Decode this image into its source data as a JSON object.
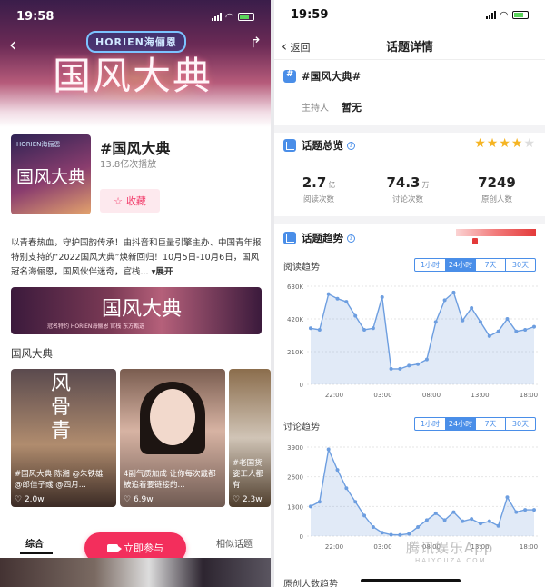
{
  "left": {
    "status": {
      "time": "19:58"
    },
    "hero": {
      "brand": "HORIEN海俪恩",
      "title": "国风大典"
    },
    "topic": {
      "name": "#国风大典",
      "plays": "13.8亿次播放",
      "fav_label": "收藏"
    },
    "thumb": {
      "brand": "HORIEN海俪恩",
      "title": "国风大典"
    },
    "description": "以青春热血，守护国韵传承！由抖音和巨量引擎主办、中国青年报特别支持的“2022国风大典”焕新回归！10月5日-10月6日，国风冠名海俪恩，国风伙伴迷奇，官栈...",
    "expand_label": "▾展开",
    "banner": {
      "title": "国风大典",
      "sponsors": "冠名特约  HORIEN海俪恩   官栈   东方甄选"
    },
    "section_title": "国风大典",
    "videos": [
      {
        "caption": "#国风大典 陈湘 @朱铁雄 @郎佳子彧 @四月...",
        "count": "2.0w",
        "overlay": "风骨青"
      },
      {
        "caption": "4副气质加成 让你每次戴都被追着要链接的...",
        "count": "6.9w"
      },
      {
        "caption": "#老国货姿工人都有",
        "count": "2.3w"
      }
    ],
    "tabs": [
      "综合",
      "相似话题"
    ],
    "join_label": "立即参与"
  },
  "right": {
    "status": {
      "time": "19:59"
    },
    "nav": {
      "back": "返回",
      "title": "话题详情"
    },
    "topic_name": "#国风大典#",
    "host_label": "主持人",
    "host_value": "暂无",
    "overview_title": "话题总览",
    "rating": 4,
    "stats": [
      {
        "value": "2.7",
        "unit": "亿",
        "label": "阅读次数"
      },
      {
        "value": "74.3",
        "unit": "万",
        "label": "讨论次数"
      },
      {
        "value": "7249",
        "unit": "",
        "label": "原创人数"
      }
    ],
    "trend_title": "话题趋势",
    "range_options": [
      "1小时",
      "24小时",
      "7天",
      "30天"
    ],
    "range_selected": "24小时",
    "watermark": "腾讯娱乐App",
    "watermark_sub": "HAIYOUZA.COM",
    "last_label": "原创人数趋势"
  },
  "chart_data": [
    {
      "type": "line",
      "title": "阅读趋势",
      "xlabel": "",
      "ylabel": "",
      "x_ticks": [
        "22:00",
        "03:00",
        "08:00",
        "13:00",
        "18:00"
      ],
      "y_ticks": [
        "0",
        "210K",
        "420K",
        "630K"
      ],
      "ylim": [
        0,
        630000
      ],
      "values": [
        360000,
        350000,
        580000,
        550000,
        530000,
        440000,
        350000,
        360000,
        560000,
        100000,
        100000,
        120000,
        130000,
        160000,
        400000,
        540000,
        590000,
        410000,
        490000,
        400000,
        310000,
        340000,
        420000,
        340000,
        350000,
        370000
      ]
    },
    {
      "type": "line",
      "title": "讨论趋势",
      "xlabel": "",
      "ylabel": "",
      "x_ticks": [
        "22:00",
        "03:00",
        "08:00",
        "13:00",
        "18:00"
      ],
      "y_ticks": [
        "0",
        "1300",
        "2600",
        "3900"
      ],
      "ylim": [
        0,
        3900
      ],
      "values": [
        1300,
        1500,
        3800,
        2900,
        2100,
        1500,
        900,
        400,
        150,
        60,
        50,
        100,
        400,
        700,
        1000,
        700,
        1050,
        650,
        750,
        550,
        650,
        450,
        1700,
        1050,
        1150,
        1150
      ]
    }
  ]
}
